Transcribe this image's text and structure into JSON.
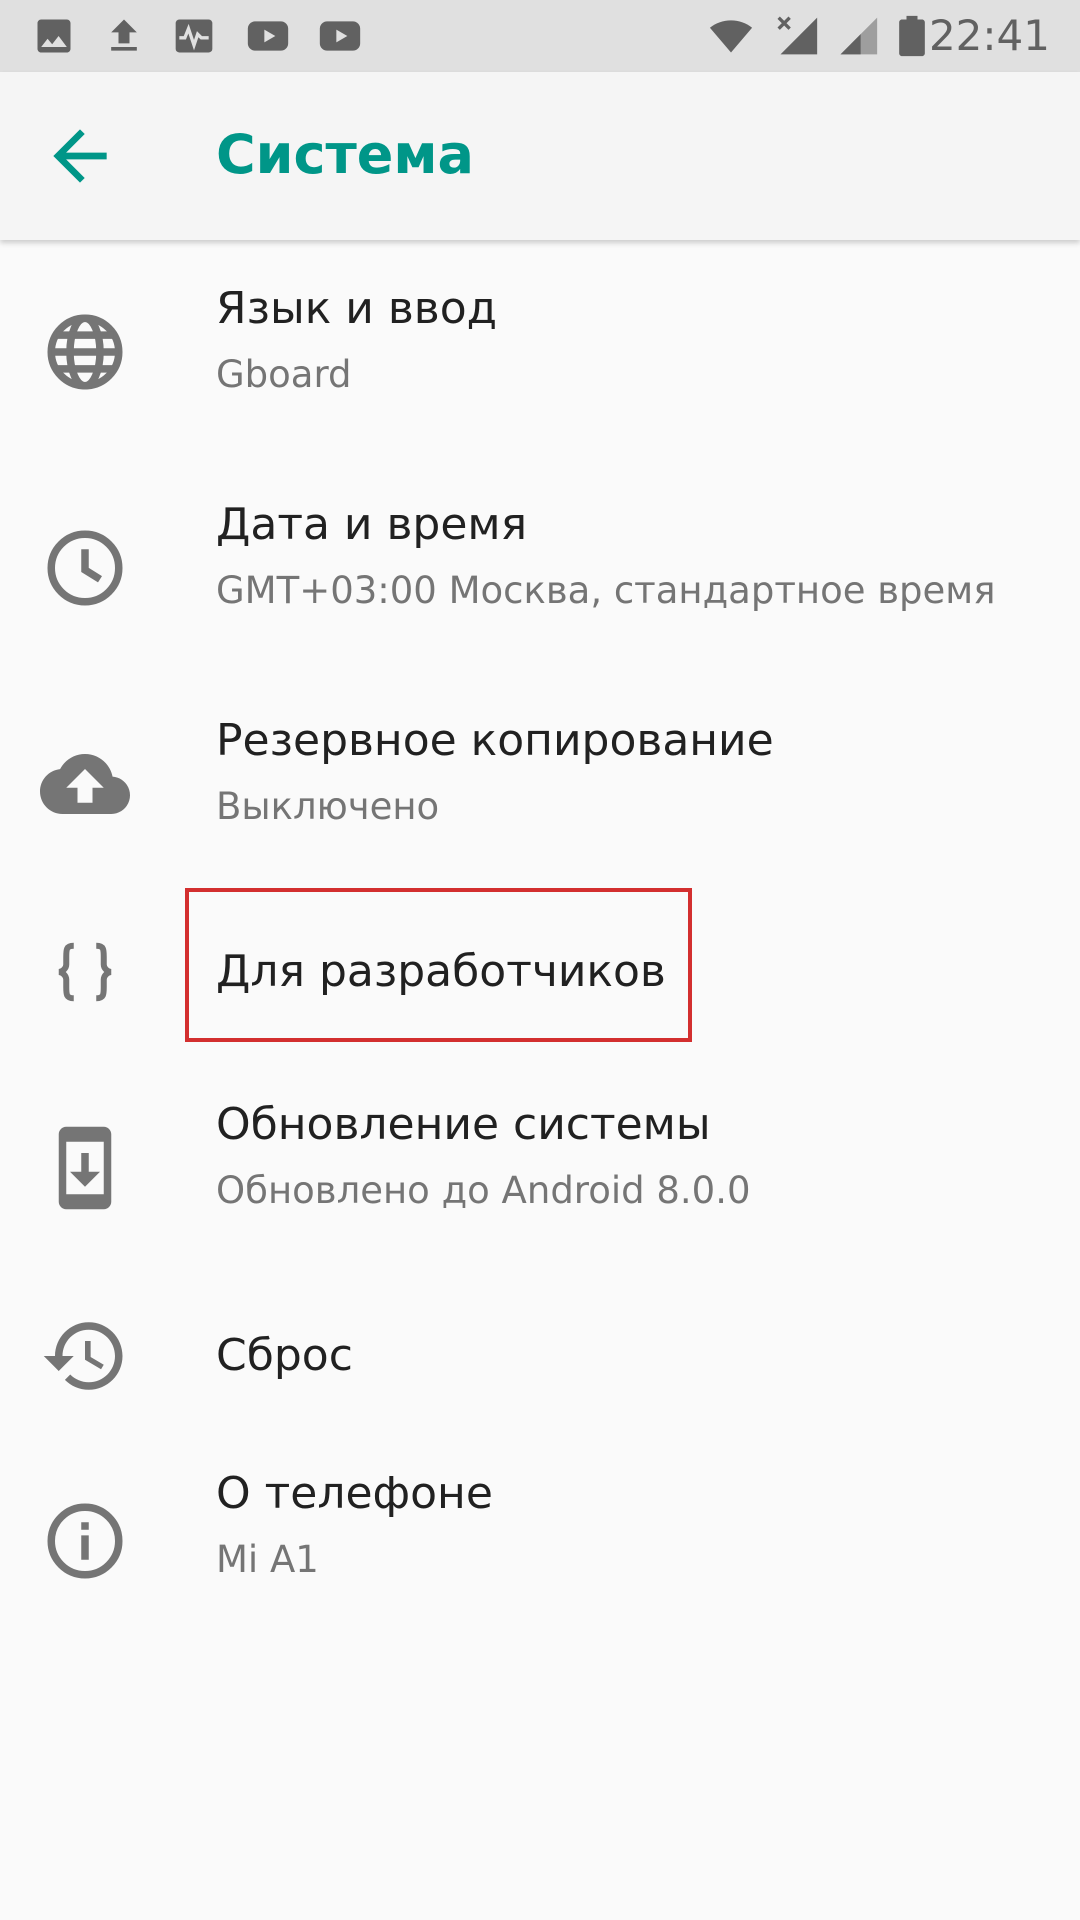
{
  "status_bar": {
    "time": "22:41",
    "icons": [
      "gallery-icon",
      "upload-icon",
      "activity-icon",
      "youtube-icon",
      "youtube-icon",
      "wifi-icon",
      "signal-no-data-icon",
      "signal-icon",
      "battery-icon"
    ]
  },
  "header": {
    "title": "Система",
    "back_icon": "arrow-back-icon"
  },
  "settings": {
    "items": [
      {
        "title": "Язык и ввод",
        "subtitle": "Gboard",
        "icon": "globe-icon"
      },
      {
        "title": "Дата и время",
        "subtitle": "GMT+03:00 Москва, стандартное время",
        "icon": "clock-icon"
      },
      {
        "title": "Резервное копирование",
        "subtitle": "Выключено",
        "icon": "cloud-upload-icon"
      },
      {
        "title": "Для разработчиков",
        "subtitle": "",
        "icon": "braces-icon",
        "highlighted": true
      },
      {
        "title": "Обновление системы",
        "subtitle": "Обновлено до Android 8.0.0",
        "icon": "system-update-icon"
      },
      {
        "title": "Сброс",
        "subtitle": "",
        "icon": "history-icon"
      },
      {
        "title": "О телефоне",
        "subtitle": "Mi A1",
        "icon": "info-icon"
      }
    ]
  },
  "colors": {
    "accent": "#009688",
    "highlight": "#d32f2f",
    "status_bar_bg": "#e0e0e0",
    "app_bar_bg": "#f5f5f5",
    "background": "#fafafa"
  }
}
